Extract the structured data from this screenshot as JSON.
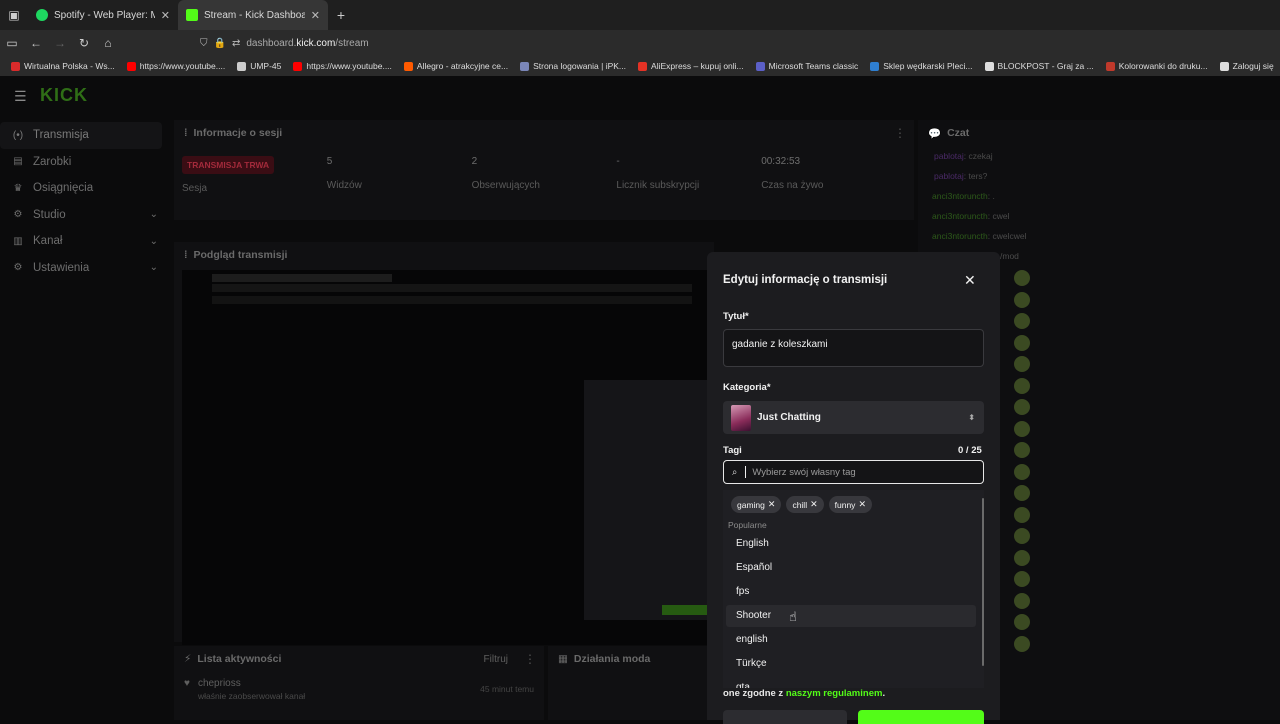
{
  "browser": {
    "tabs": [
      {
        "title": "Spotify - Web Player: Music for",
        "favicon": "spotify-icon"
      },
      {
        "title": "Stream - Kick Dashboard",
        "favicon": "kick-icon"
      }
    ],
    "url_prefix": "dashboard.",
    "url_domain": "kick.com",
    "url_path": "/stream",
    "bookmarks": [
      {
        "label": "Wirtualna Polska - Ws...",
        "color": "#d92b2b"
      },
      {
        "label": "https://www.youtube....",
        "color": "#ff0000"
      },
      {
        "label": "UMP-45",
        "color": "#cccccc"
      },
      {
        "label": "https://www.youtube....",
        "color": "#ff0000"
      },
      {
        "label": "Allegro - atrakcyjne ce...",
        "color": "#ff5a00"
      },
      {
        "label": "Strona logowania | iPK...",
        "color": "#7a86b8"
      },
      {
        "label": "AliExpress – kupuj onli...",
        "color": "#e43225"
      },
      {
        "label": "Microsoft Teams classic",
        "color": "#5b5fc7"
      },
      {
        "label": "Sklep wędkarski Pleci...",
        "color": "#2f7fd1"
      },
      {
        "label": "BLOCKPOST - Graj za ...",
        "color": "#dddddd"
      },
      {
        "label": "Kolorowanki do druku...",
        "color": "#c0392b"
      },
      {
        "label": "Zaloguj się",
        "color": "#dddddd"
      }
    ]
  },
  "app": {
    "logo": "KICK",
    "sidebar": [
      {
        "label": "Transmisja",
        "icon": "broadcast-icon",
        "active": true
      },
      {
        "label": "Zarobki",
        "icon": "earnings-icon"
      },
      {
        "label": "Osiągnięcia",
        "icon": "trophy-icon"
      },
      {
        "label": "Studio",
        "icon": "studio-icon",
        "chevron": true
      },
      {
        "label": "Kanał",
        "icon": "channel-icon",
        "chevron": true
      },
      {
        "label": "Ustawienia",
        "icon": "settings-icon",
        "chevron": true
      }
    ],
    "session": {
      "title": "Informacje o sesji",
      "badge": "TRANSMISJA TRWA",
      "cells": [
        {
          "value": "",
          "label": "Sesja"
        },
        {
          "value": "5",
          "label": "Widzów"
        },
        {
          "value": "2",
          "label": "Obserwujących"
        },
        {
          "value": "-",
          "label": "Licznik subskrypcji"
        },
        {
          "value": "00:32:53",
          "label": "Czas na żywo"
        }
      ]
    },
    "preview": {
      "title": "Podgląd transmisji"
    },
    "activity": {
      "title": "Lista aktywności",
      "filter": "Filtruj",
      "item_user": "chepriоss",
      "item_text": "właśnie zaobserwował kanał",
      "item_time": "45 minut temu"
    },
    "mod": {
      "title": "Działania moda"
    },
    "chat": {
      "title": "Czat",
      "messages": [
        {
          "user": "pablotaj",
          "text": ": czekaj",
          "purple": true
        },
        {
          "user": "pablotaj",
          "text": ": ters?",
          "purple": true
        },
        {
          "user": "anci3ntoruncth",
          "text": ": .",
          "purple": false
        },
        {
          "user": "anci3ntoruncth",
          "text": ": cwel",
          "purple": false
        },
        {
          "user": "anci3ntoruncth",
          "text": ": cwelcwel",
          "purple": false
        }
      ],
      "mod_text": "/mod"
    }
  },
  "modal": {
    "title": "Edytuj informację o transmisji",
    "title_label": "Tytuł*",
    "title_value": "gadanie z koleszkami",
    "category_label": "Kategoria*",
    "category_value": "Just Chatting",
    "tags_label": "Tagi",
    "tags_count": "0 / 25",
    "tag_placeholder": "Wybierz swój własny tag",
    "selected_tags": [
      "gaming",
      "chill",
      "funny"
    ],
    "popular_label": "Popularne",
    "options": [
      "English",
      "Español",
      "fps",
      "Shooter",
      "english",
      "Türkçe",
      "gta"
    ],
    "hovered_option": "Shooter",
    "rules_prefix": "one zgodne z ",
    "rules_link": "naszym regulaminem",
    "rules_suffix": "."
  }
}
